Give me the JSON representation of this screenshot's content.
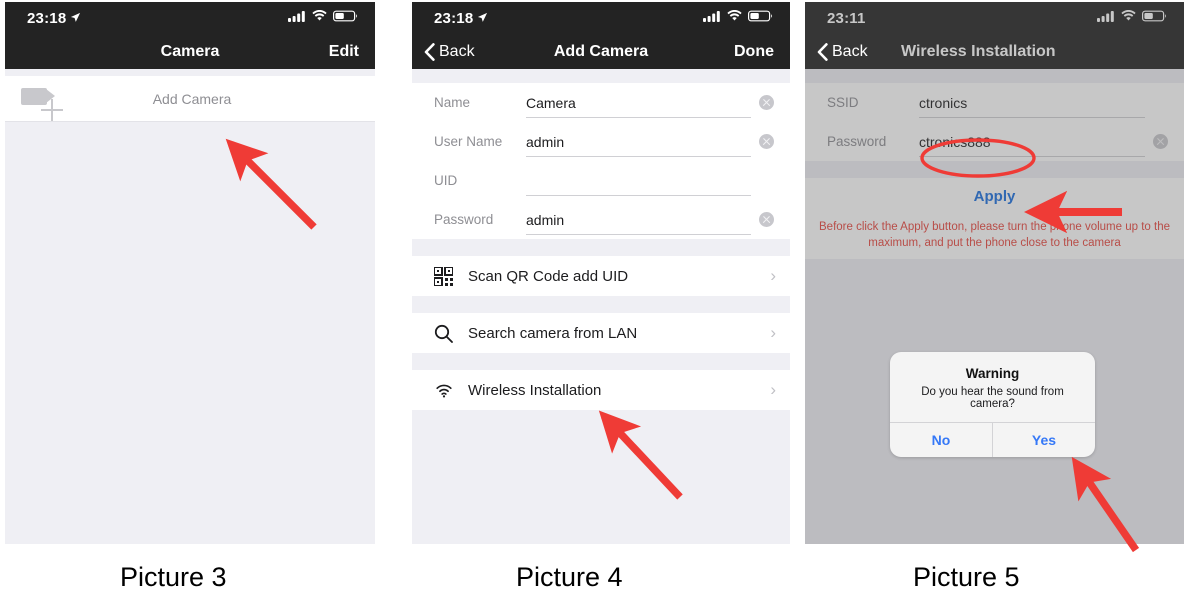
{
  "panels": [
    {
      "id": "camera-list",
      "statusbar": {
        "time": "23:18",
        "location_icon": "location-arrow-icon",
        "signal_icon": "cellular-signal-icon",
        "wifi_icon": "wifi-icon",
        "battery_icon": "battery-icon"
      },
      "nav": {
        "title": "Camera",
        "right_label": "Edit"
      },
      "list": {
        "add_camera_label": "Add Camera",
        "camera_icon": "video-camera-add-icon"
      },
      "caption": "Picture 3"
    },
    {
      "id": "add-camera",
      "statusbar": {
        "time": "23:18",
        "location_icon": "location-arrow-icon",
        "signal_icon": "cellular-signal-icon",
        "wifi_icon": "wifi-icon",
        "battery_icon": "battery-icon"
      },
      "nav": {
        "back_label": "Back",
        "title": "Add Camera",
        "right_label": "Done"
      },
      "form": [
        {
          "label": "Name",
          "value": "Camera",
          "clearable": true
        },
        {
          "label": "User Name",
          "value": "admin",
          "clearable": true
        },
        {
          "label": "UID",
          "value": "",
          "clearable": false
        },
        {
          "label": "Password",
          "value": "admin",
          "clearable": true
        }
      ],
      "actions": [
        {
          "label": "Scan QR Code add UID",
          "icon": "qr-code-icon"
        },
        {
          "label": "Search camera from LAN",
          "icon": "search-icon"
        },
        {
          "label": "Wireless Installation",
          "icon": "wifi-icon"
        }
      ],
      "caption": "Picture 4"
    },
    {
      "id": "wireless-installation",
      "statusbar": {
        "time": "23:11",
        "signal_icon": "cellular-signal-icon",
        "wifi_icon": "wifi-icon",
        "battery_icon": "battery-icon"
      },
      "nav": {
        "back_label": "Back",
        "title": "Wireless Installation"
      },
      "form": [
        {
          "label": "SSID",
          "value": "ctronics",
          "clearable": false
        },
        {
          "label": "Password",
          "value": "ctronics888",
          "clearable": true
        }
      ],
      "apply_label": "Apply",
      "warning_text": "Before click the Apply button, please turn the phone volume up to the maximum, and put the phone close to the camera",
      "alert": {
        "title": "Warning",
        "message": "Do you hear the sound from camera?",
        "buttons": [
          "No",
          "Yes"
        ]
      },
      "caption": "Picture 5"
    }
  ],
  "annotations": {
    "accent_red": "#ef3b36",
    "arrow_add_camera": "arrow-pointing-to-add-camera-row",
    "arrow_wireless_installation": "arrow-pointing-to-wireless-installation-row",
    "arrow_apply": "arrow-pointing-to-apply-button",
    "arrow_yes": "arrow-pointing-to-yes-button",
    "ellipse_password": "ellipse-highlighting-password-value"
  }
}
